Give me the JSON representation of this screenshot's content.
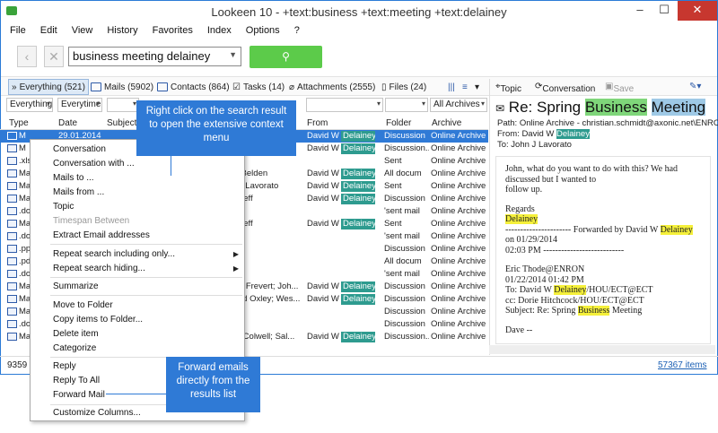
{
  "window": {
    "title": "Lookeen 10 - +text:business +text:meeting +text:delainey",
    "controls": {
      "minimize": "–",
      "maximize": "☐",
      "close": "✕"
    }
  },
  "menu": [
    "File",
    "Edit",
    "View",
    "History",
    "Favorites",
    "Index",
    "Options",
    "?"
  ],
  "search": {
    "query": "business meeting delainey"
  },
  "tabs": [
    {
      "label": "Everything (521)",
      "active": true
    },
    {
      "label": "Mails (5902)"
    },
    {
      "label": "Contacts (864)"
    },
    {
      "label": "Tasks (14)"
    },
    {
      "label": "Attachments (2555)"
    },
    {
      "label": "Files (24)"
    }
  ],
  "filters": {
    "everything": "Everything",
    "everytime": "Everytime",
    "archives": "All Archives"
  },
  "columns": {
    "type": "Type",
    "date": "Date",
    "subject": "Subject",
    "from": "From",
    "folder": "Folder",
    "archive": "Archive"
  },
  "rows": [
    {
      "type": "M",
      "date": "29.01.2014",
      "subject": "Re: Spri",
      "from": "David W",
      "tag": "Delainey",
      "folder": "Discussion",
      "archive": "Online Archive",
      "selected": true
    },
    {
      "type": "M",
      "date": "",
      "subject": "s Colwell; Sal...",
      "from": "David W",
      "tag": "Delainey",
      "folder": "Discussion...",
      "archive": "Online Archive"
    },
    {
      "type": ".xls",
      "date": "",
      "subject": "",
      "from": "",
      "tag": "",
      "folder": "Sent",
      "archive": "Online Archive"
    },
    {
      "type": "Ma",
      "date": "",
      "subject": "m Belden",
      "from": "David W",
      "tag": "Delainey",
      "folder": "All docum",
      "archive": "Online Archive"
    },
    {
      "type": "Ma",
      "date": "",
      "subject": "n J Lavorato",
      "from": "David W",
      "tag": "Delainey",
      "folder": "Sent",
      "archive": "Online Archive"
    },
    {
      "type": "Ma",
      "date": "",
      "subject": "n Leff",
      "from": "David W",
      "tag": "Delainey",
      "folder": "Discussion",
      "archive": "Online Archive"
    },
    {
      "type": ".do",
      "date": "",
      "subject": "",
      "from": "",
      "tag": "",
      "folder": "'sent mail",
      "archive": "Online Archive"
    },
    {
      "type": "Ma",
      "date": "",
      "subject": "n Leff",
      "from": "David W",
      "tag": "Delainey",
      "folder": "Sent",
      "archive": "Online Archive"
    },
    {
      "type": ".do",
      "date": "",
      "subject": "",
      "from": "",
      "tag": "",
      "folder": "'sent mail",
      "archive": "Online Archive"
    },
    {
      "type": ".pp",
      "date": "",
      "subject": "",
      "from": "",
      "tag": "",
      "folder": "Discussion",
      "archive": "Online Archive"
    },
    {
      "type": ".pd",
      "date": "",
      "subject": "",
      "from": "",
      "tag": "",
      "folder": "All docum",
      "archive": "Online Archive"
    },
    {
      "type": ".do",
      "date": "",
      "subject": "",
      "from": "",
      "tag": "",
      "folder": "'sent mail",
      "archive": "Online Archive"
    },
    {
      "type": "Ma",
      "date": "",
      "subject": "ark Frevert; Joh...",
      "from": "David W",
      "tag": "Delainey",
      "folder": "Discussion",
      "archive": "Online Archive"
    },
    {
      "type": "Ma",
      "date": "",
      "subject": "avid Oxley; Wes...",
      "from": "David W",
      "tag": "Delainey",
      "folder": "Discussion",
      "archive": "Online Archive"
    },
    {
      "type": "Ma",
      "date": "",
      "subject": "",
      "from": "",
      "tag": "",
      "folder": "Discussion",
      "archive": "Online Archive"
    },
    {
      "type": ".do",
      "date": "",
      "subject": "",
      "from": "",
      "tag": "",
      "folder": "Discussion",
      "archive": "Online Archive"
    },
    {
      "type": "Ma",
      "date": "",
      "subject": "es Colwell; Sal...",
      "from": "David W",
      "tag": "Delainey",
      "folder": "Discussion...",
      "archive": "Online Archive"
    }
  ],
  "status": {
    "count": "9359 i",
    "items": "57367 items"
  },
  "preview": {
    "tools": {
      "topic": "Topic",
      "conversation": "Conversation",
      "save": "Save"
    },
    "subject": {
      "prefix": "Re: Spring ",
      "w1": "Business",
      "w2": "Meeting"
    },
    "path": "Path: Online Archive - christian.schmidt@axonic.net\\ENRON\\",
    "from_prefix": "From: David W ",
    "from_tag": "Delainey",
    "to": "To: John J Lavorato",
    "body": {
      "l1": "John, what do you want to do with this?  We had",
      "l2": "discussed but I wanted to",
      "l3": "follow up.",
      "l4": "Regards",
      "l5": "Delainey",
      "l6": "---------------------- Forwarded by David W ",
      "l6b": "Delainey",
      "l7": "on 01/29/2014",
      "l8": "02:03 PM ---------------------------",
      "l9": "Eric Thode@ENRON",
      "l10": "01/22/2014 01:42 PM",
      "l11a": "To: David W ",
      "l11b": "Delainey",
      "l11c": "/HOU/ECT@ECT",
      "l12a": "cc: Dorie Hitchcock/HOU/ECT@ECT",
      "l13a": "Subject: Re: Spring ",
      "l13b": "Business",
      "l13c": " Meeting",
      "l14": "Dave --"
    }
  },
  "context_menu": {
    "conversation": "Conversation",
    "conversation_with": "Conversation with ...",
    "mails_to": "Mails to ...",
    "mails_from": "Mails from ...",
    "topic": "Topic",
    "timespan": "Timespan Between",
    "extract": "Extract Email addresses",
    "repeat_incl": "Repeat search including only...",
    "repeat_hide": "Repeat search hiding...",
    "summarize": "Summarize",
    "move": "Move to Folder",
    "copy": "Copy items to Folder...",
    "delete": "Delete item",
    "categorize": "Categorize",
    "reply": "Reply",
    "reply_all": "Reply To All",
    "forward": "Forward Mail",
    "customize": "Customize Columns..."
  },
  "callouts": {
    "one": "Right click on the search result to open the extensive context menu",
    "two": "Forward emails directly from the results list"
  },
  "colors": {
    "accent": "#2f7ad6",
    "search_button": "#5ccb4a",
    "tag": "#2e9b8f",
    "highlight": "#f5f03a"
  }
}
